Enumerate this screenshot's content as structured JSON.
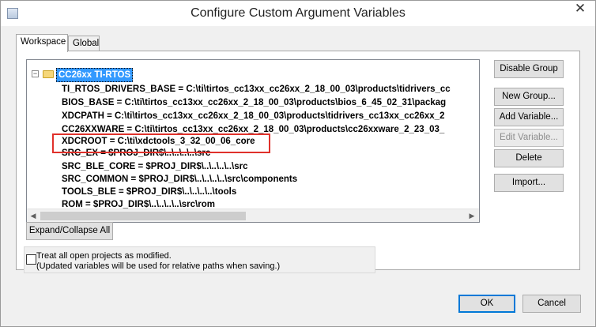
{
  "window": {
    "title": "Configure Custom Argument Variables",
    "close_symbol": "✕"
  },
  "tabs": [
    {
      "label": "Workspace",
      "active": true
    },
    {
      "label": "Global",
      "active": false
    }
  ],
  "tree": {
    "root": {
      "label": "CC26xx TI-RTOS",
      "expander": "−",
      "icon": "folder-icon"
    },
    "items": [
      "TI_RTOS_DRIVERS_BASE = C:\\ti\\tirtos_cc13xx_cc26xx_2_18_00_03\\products\\tidrivers_cc",
      "BIOS_BASE = C:\\ti\\tirtos_cc13xx_cc26xx_2_18_00_03\\products\\bios_6_45_02_31\\packag",
      "XDCPATH = C:\\ti\\tirtos_cc13xx_cc26xx_2_18_00_03\\products\\tidrivers_cc13xx_cc26xx_2",
      "CC26XXWARE = C:\\ti\\tirtos_cc13xx_cc26xx_2_18_00_03\\products\\cc26xxware_2_23_03_",
      "XDCROOT = C:\\ti\\xdctools_3_32_00_06_core",
      "SRC_EX = $PROJ_DIR$\\..\\..\\..\\..\\src",
      "SRC_BLE_CORE = $PROJ_DIR$\\..\\..\\..\\..\\src",
      "SRC_COMMON = $PROJ_DIR$\\..\\..\\..\\..\\src\\components",
      "TOOLS_BLE = $PROJ_DIR$\\..\\..\\..\\..\\tools",
      "ROM = $PROJ_DIR$\\..\\..\\..\\..\\src\\rom"
    ],
    "scroll_left": "◀",
    "scroll_right": "▶"
  },
  "side_buttons": {
    "disable_group": "Disable Group",
    "new_group": "New Group...",
    "add_variable": "Add Variable...",
    "edit_variable": "Edit Variable...",
    "delete": "Delete",
    "import": "Import..."
  },
  "expand_collapse": "Expand/Collapse All",
  "treat_all": {
    "label": "Treat all open projects as modified.",
    "note": "(Updated variables will be used for relative paths when saving.)",
    "checked": false
  },
  "footer": {
    "ok": "OK",
    "cancel": "Cancel"
  },
  "colors": {
    "selection": "#3399ff",
    "highlight_box": "#e0312b",
    "default_button_border": "#0078d7"
  }
}
